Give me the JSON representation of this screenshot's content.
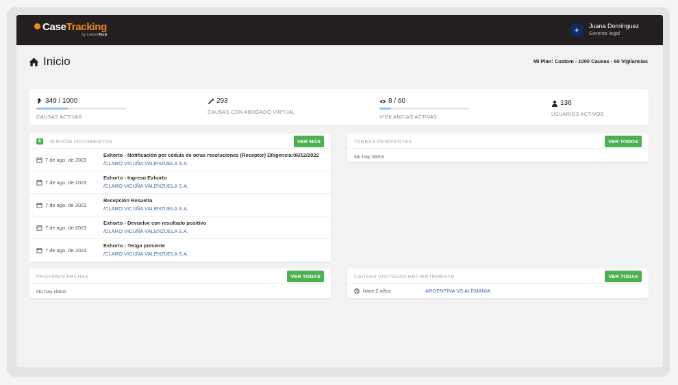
{
  "header": {
    "logo_case": "Case",
    "logo_tracking": "Tracking",
    "logo_by": "by Lemon",
    "logo_tech": "Tech",
    "avatar_symbol": "+",
    "user_name": "Juana Domínguez",
    "user_role": "Gerente legal"
  },
  "page": {
    "title": "Inicio",
    "plan": "Mi Plan: Custom - 1000 Causas - 60 Vigilancias"
  },
  "stats": [
    {
      "icon": "gavel-icon",
      "value": "349 / 1000",
      "label": "CAUSAS ACTIVAS",
      "progress": 0.349
    },
    {
      "icon": "magic-wand-icon",
      "value": "293",
      "label": "CAUSAS CON ABOGADO VIRTUAL"
    },
    {
      "icon": "eye-icon",
      "value": "8 / 60",
      "label": "VIGILANCIAS ACTIVAS",
      "progress": 0.133
    },
    {
      "icon": "user-icon",
      "value": "136",
      "label": "USUARIOS ACTIVOS"
    }
  ],
  "movimientos": {
    "count": "6",
    "title": "NUEVOS MOVIMIENTOS",
    "button": "VER MÁS",
    "rows": [
      {
        "date": "7 de ago. de 2023",
        "title": "Exhorto - Notificación por cédula de otras resoluciones (Receptor) Diligencia:06/12/2022",
        "case": "/CLARO VICUÑA VALENZUELA S.A."
      },
      {
        "date": "7 de ago. de 2023",
        "title": "Exhorto - Ingreso Exhorto",
        "case": "/CLARO VICUÑA VALENZUELA S.A."
      },
      {
        "date": "7 de ago. de 2023",
        "title": "Recepción Resuelta",
        "case": "/CLARO VICUÑA VALENZUELA S.A."
      },
      {
        "date": "7 de ago. de 2023",
        "title": "Exhorto - Devuelve con resultado positivo",
        "case": "/CLARO VICUÑA VALENZUELA S.A."
      },
      {
        "date": "7 de ago. de 2023",
        "title": "Exhorto - Tenga presente",
        "case": "/CLARO VICUÑA VALENZUELA S.A."
      }
    ]
  },
  "tareas": {
    "title": "TAREAS PENDIENTES",
    "button": "VER TODOS",
    "empty": "No hay datos"
  },
  "proximas": {
    "title": "PRÓXIMAS FECHAS",
    "button": "VER TODAS",
    "empty": "No hay datos"
  },
  "visitadas": {
    "title": "CAUSAS VISITADAS RECIENTEMENTE",
    "button": "VER TODAS",
    "rows": [
      {
        "time": "hace 2 años",
        "case": "ARGENTINA VS ALEMANIA"
      }
    ]
  },
  "colors": {
    "accent": "#f28b1c",
    "green": "#4caf50",
    "link": "#3a6ea5",
    "topbar": "#231f20"
  }
}
